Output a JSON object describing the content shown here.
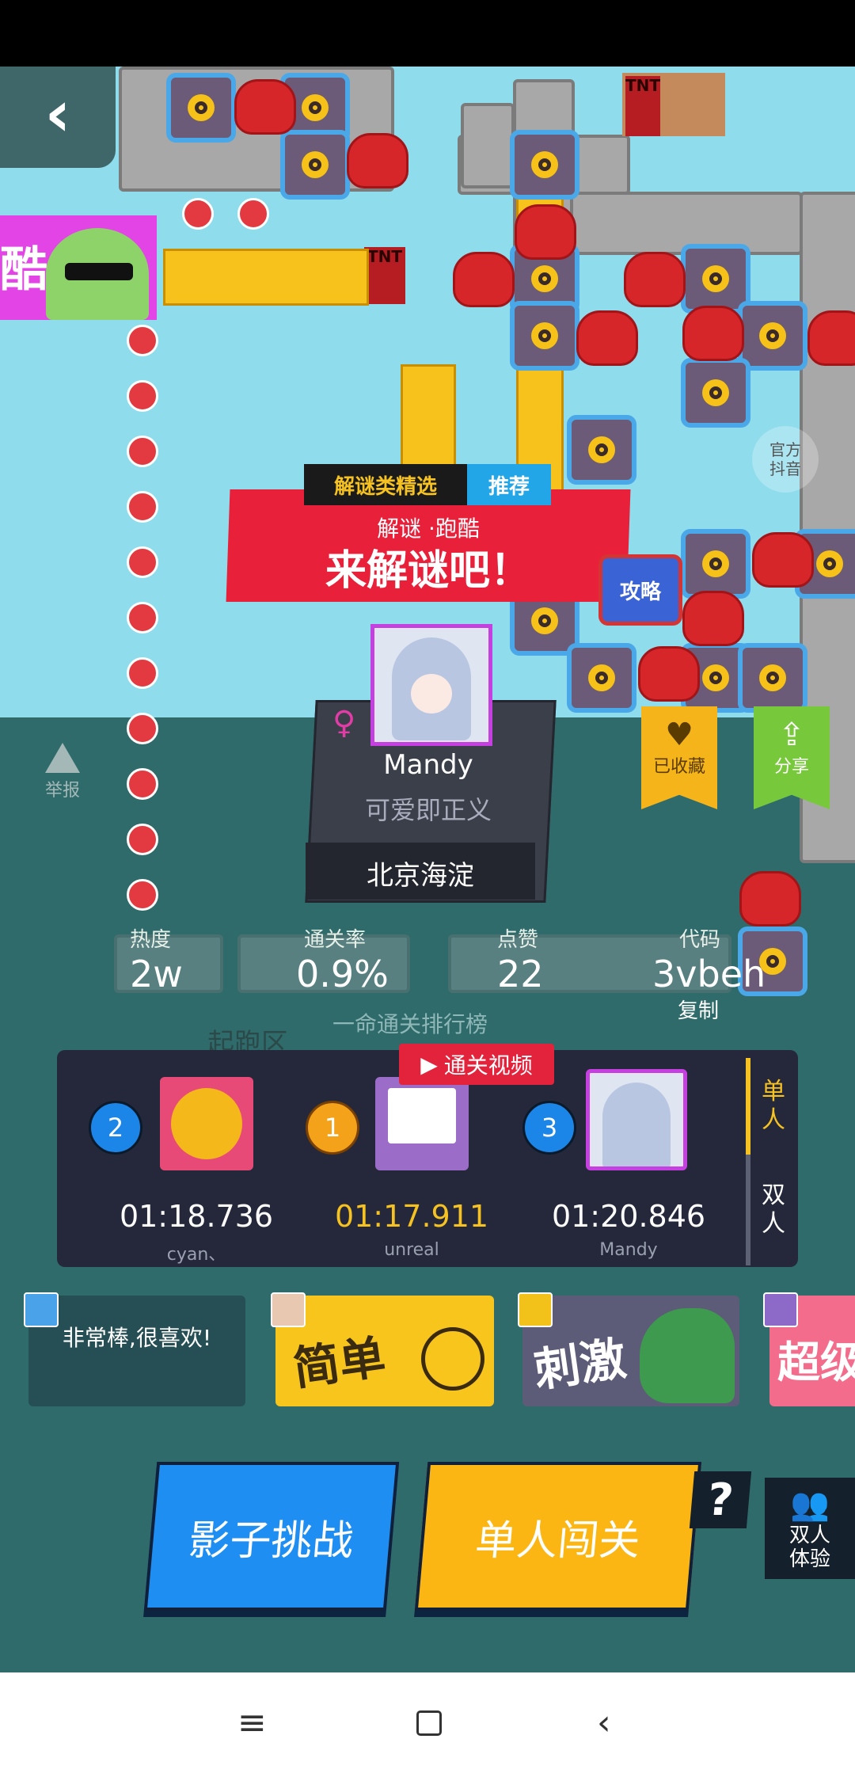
{
  "header": {
    "back_icon": "chevron-left-icon"
  },
  "banner_left": {
    "text": "酷"
  },
  "official": {
    "line1": "官方",
    "line2": "抖音"
  },
  "promo": {
    "tag_primary": "解谜类精选",
    "tag_secondary": "推荐",
    "subtitle": "解谜 ·跑酷",
    "title": "来解谜吧！",
    "guide_label": "攻略"
  },
  "author": {
    "gender_symbol": "♀",
    "name": "Mandy",
    "motto": "可爱即正义",
    "location": "北京海淀"
  },
  "actions": {
    "report_label": "举报",
    "favorite_label": "已收藏",
    "share_label": "分享"
  },
  "stats": {
    "heat_label": "热度",
    "heat_value": "2w",
    "pass_rate_label": "通关率",
    "pass_rate_value": "0.9%",
    "likes_label": "点赞",
    "likes_value": "22",
    "code_label": "代码",
    "code_value": "3vbeh",
    "copy_label": "复制"
  },
  "leaderboard": {
    "title": "一命通关排行榜",
    "start_area_label": "起跑区",
    "video_label": "通关视频",
    "mode_single": "单人",
    "mode_double": "双人",
    "entries": [
      {
        "rank": "2",
        "time": "01:18.736",
        "name": "cyan、"
      },
      {
        "rank": "1",
        "time": "01:17.911",
        "name": "unreal"
      },
      {
        "rank": "3",
        "time": "01:20.846",
        "name": "Mandy"
      }
    ]
  },
  "tags": {
    "comment": "非常棒,很喜欢!",
    "easy": "简单",
    "exciting": "刺激",
    "super": "超级"
  },
  "buttons": {
    "shadow_challenge": "影子挑战",
    "solo_play": "单人闯关",
    "help": "?",
    "duo_line1": "双人",
    "duo_line2": "体验"
  },
  "colors": {
    "sky": "#8fdcec",
    "lower_bg": "#2f6b6b",
    "promo_red": "#e8203a",
    "gold": "#f5c221",
    "blue_button": "#1f8ef2",
    "orange_button": "#fbb614",
    "share_green": "#77c83a",
    "board_bg": "#24283a"
  }
}
